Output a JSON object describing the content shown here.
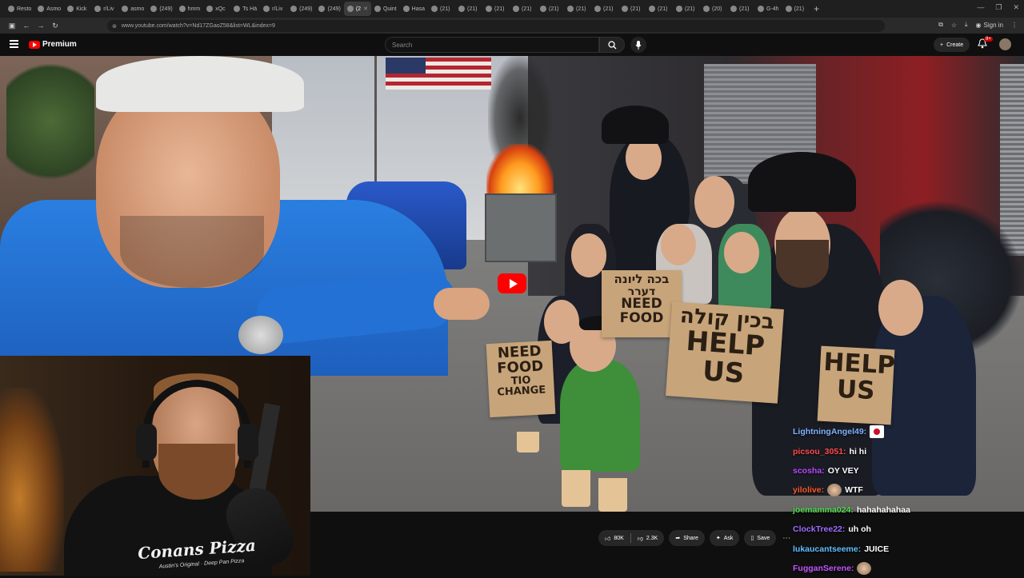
{
  "browser": {
    "tabs": [
      {
        "label": "Resto"
      },
      {
        "label": "Asmo"
      },
      {
        "label": "Kick"
      },
      {
        "label": "r/Liv"
      },
      {
        "label": "asmo"
      },
      {
        "label": "(249)"
      },
      {
        "label": "hmm"
      },
      {
        "label": "xQc"
      },
      {
        "label": "Ts Hä"
      },
      {
        "label": "r/Liv"
      },
      {
        "label": "(249)"
      },
      {
        "label": "(249)"
      },
      {
        "label": "(2"
      },
      {
        "label": "Quint"
      },
      {
        "label": "Hasa"
      },
      {
        "label": "(21)"
      },
      {
        "label": "(21)"
      },
      {
        "label": "(21)"
      },
      {
        "label": "(21)"
      },
      {
        "label": "(21)"
      },
      {
        "label": "(21)"
      },
      {
        "label": "(21)"
      },
      {
        "label": "(21)"
      },
      {
        "label": "(21)"
      },
      {
        "label": "(21)"
      },
      {
        "label": "(20)"
      },
      {
        "label": "(21)"
      },
      {
        "label": "G-4h"
      },
      {
        "label": "(21)"
      }
    ],
    "active_tab_index": 12,
    "url": "www.youtube.com/watch?v=Nd17ZGaoZ58&list=WL&index=9",
    "signin_label": "Sign in"
  },
  "youtube": {
    "brand": "Premium",
    "search_placeholder": "Search",
    "create_label": "Create",
    "notif_count": "9+"
  },
  "video": {
    "signs": {
      "sign1_hebrew": "בכה ליונה",
      "sign1_line2": "דערר",
      "sign1_text": "NEED FOOD",
      "sign2_hebrew": "בכין קולה",
      "sign2_text": "HELP US",
      "sign3_text": "NEED FOOD",
      "sign3_line2": "TIO CHANGE",
      "sign4_text": "HELP US"
    }
  },
  "webcam": {
    "shirt_text": "Conans Pizza",
    "shirt_sub": "Austin's Original · Deep Pan Pizza"
  },
  "actions": {
    "likes": "80K",
    "dislikes": "2.3K",
    "share": "Share",
    "ask": "Ask",
    "save": "Save"
  },
  "chat": [
    {
      "user": "LightningAngel49:",
      "msg": "",
      "emote": "flag",
      "color": "#7fb2ff"
    },
    {
      "user": "picsou_3051:",
      "msg": "hi hi",
      "emote": "",
      "color": "#ff4a4a"
    },
    {
      "user": "scosha:",
      "msg": "OY VEY",
      "emote": "",
      "color": "#b84aff"
    },
    {
      "user": "yilolive:",
      "msg": "WTF",
      "emote": "face",
      "color": "#ff5a2a"
    },
    {
      "user": "joemamma024:",
      "msg": "hahahahahaa",
      "emote": "",
      "color": "#4fdc4f"
    },
    {
      "user": "ClockTree22:",
      "msg": "uh oh",
      "emote": "",
      "color": "#a06bff"
    },
    {
      "user": "lukaucantseeme:",
      "msg": "JUICE",
      "emote": "",
      "color": "#5fc0ff"
    },
    {
      "user": "FugganSerene:",
      "msg": "",
      "emote": "face",
      "color": "#c454ff"
    }
  ]
}
